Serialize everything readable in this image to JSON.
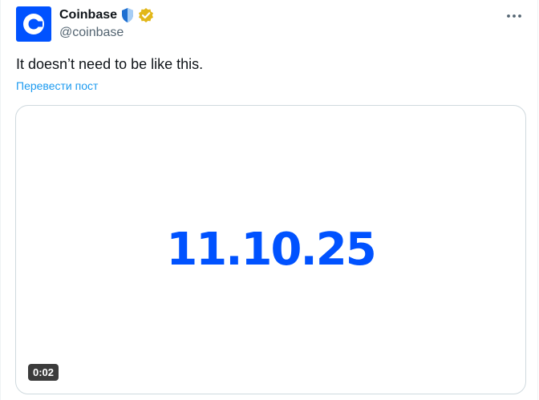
{
  "author": {
    "display_name": "Coinbase",
    "handle": "@coinbase",
    "brand_color": "#0052ff",
    "avatar_icon": "coinbase-c-logo-icon",
    "badges": [
      "blue-shield-badge-icon",
      "gold-verified-badge-icon"
    ]
  },
  "post": {
    "text": "It doesn’t need to be like this.",
    "translate_label": "Перевести пост",
    "more_icon": "more-dots-icon"
  },
  "media": {
    "headline": "11.10.25",
    "headline_color": "#0052ff",
    "duration": "0:02"
  }
}
